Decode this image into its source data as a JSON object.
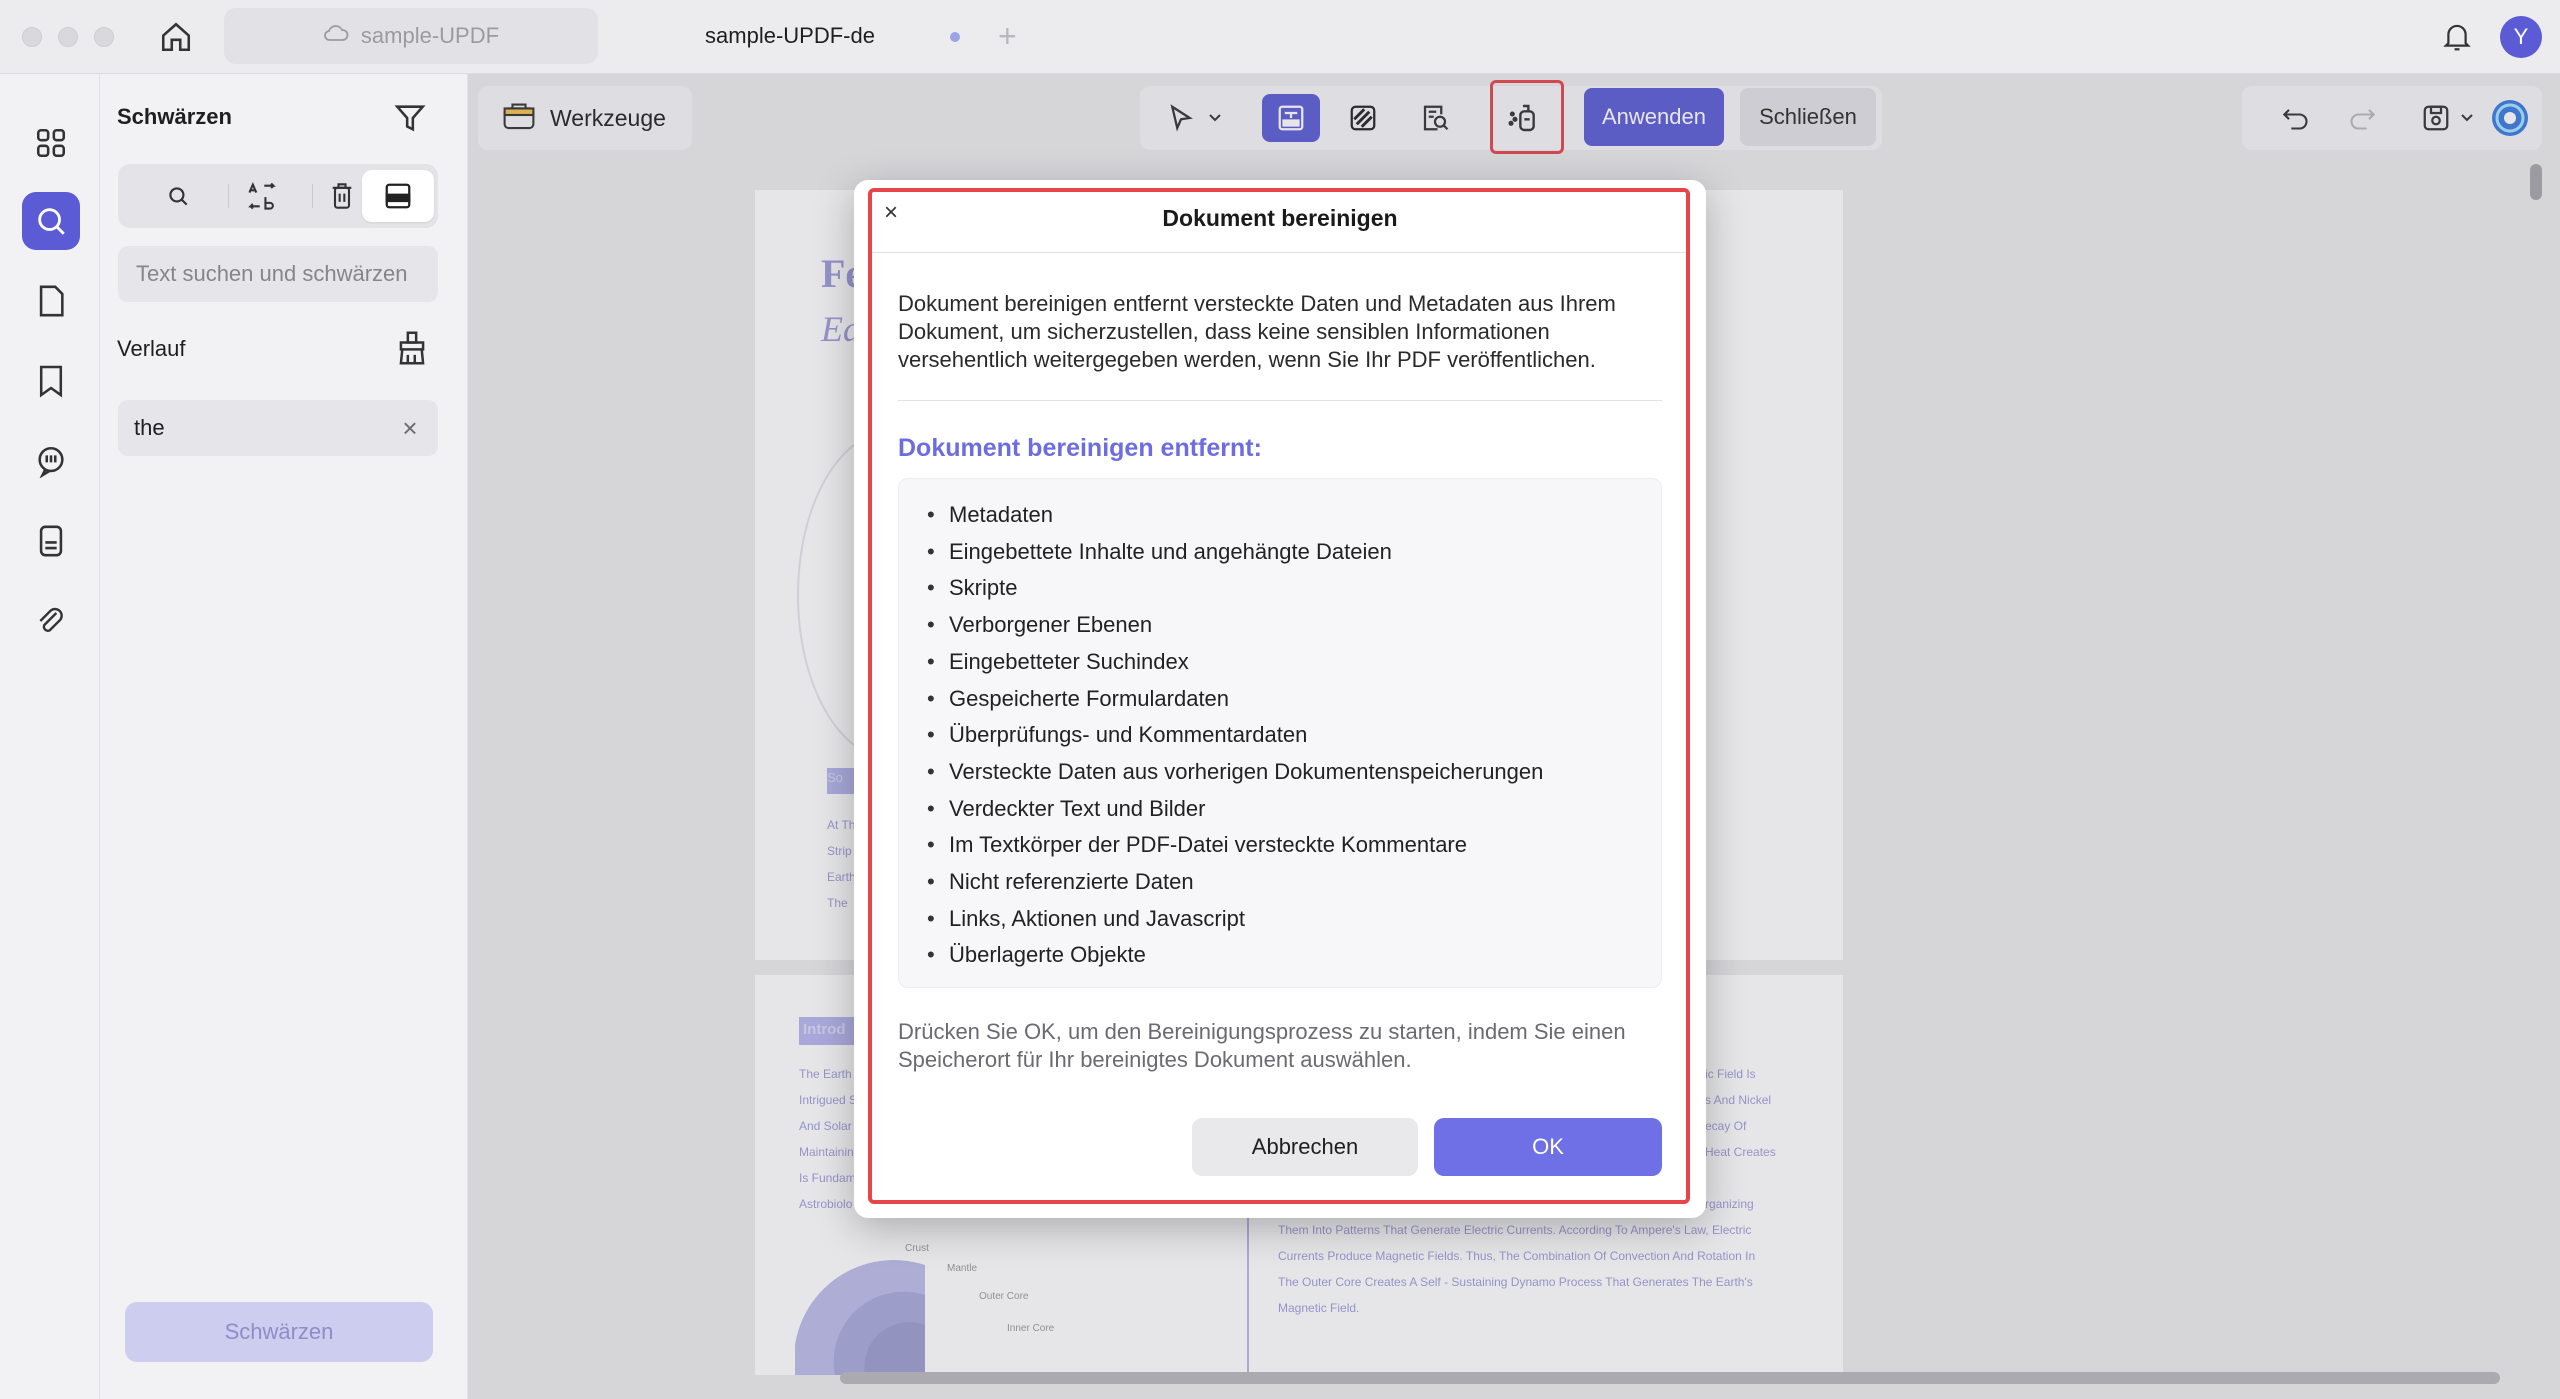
{
  "titlebar": {
    "tabs": [
      {
        "label": "sample-UPDF"
      },
      {
        "label": "sample-UPDF-de"
      }
    ],
    "avatar_initial": "Y"
  },
  "panel": {
    "title": "Schwärzen",
    "search_placeholder": "Text suchen und schwärzen",
    "history_label": "Verlauf",
    "history_items": [
      "the"
    ],
    "redact_button": "Schwärzen"
  },
  "toolbar": {
    "tools_label": "Werkzeuge",
    "apply_label": "Anwenden",
    "close_label": "Schließen"
  },
  "dialog": {
    "title": "Dokument bereinigen",
    "description": "Dokument bereinigen entfernt versteckte Daten und Metadaten aus Ihrem Dokument, um sicherzustellen, dass keine sensiblen Informationen versehentlich weitergegeben werden, wenn Sie Ihr PDF veröffentlichen.",
    "list_title": "Dokument bereinigen entfernt:",
    "items": [
      "Metadaten",
      "Eingebettete Inhalte und angehängte Dateien",
      "Skripte",
      "Verborgener Ebenen",
      "Eingebetteter Suchindex",
      "Gespeicherte Formulardaten",
      "Überprüfungs- und Kommentardaten",
      "Versteckte Daten aus vorherigen Dokumentenspeicherungen",
      "Verdeckter Text und Bilder",
      "Im Textkörper der PDF-Datei versteckte Kommentare",
      "Nicht referenzierte Daten",
      "Links, Aktionen und Javascript",
      "Überlagerte Objekte"
    ],
    "footer": "Drücken Sie OK, um den Bereinigungsprozess zu starten, indem Sie einen Speicherort für Ihr bereinigtes Dokument auswählen.",
    "cancel_label": "Abbrechen",
    "ok_label": "OK"
  },
  "document": {
    "page1_fragments": [
      "Fe",
      "Ea",
      "So",
      "At Th",
      "Strip",
      "Earth",
      "The"
    ],
    "page2_fragments": [
      "Introd",
      "The Earth",
      "Intrigued S",
      "And Solar",
      "Maintainin",
      "Is Fundam",
      "Astrobiolo",
      "Crust",
      "Mantle",
      "Outer Core",
      "Inner Core"
    ],
    "page2_right_text": [
      "ic Field Is",
      "s And Nickel",
      "ecay Of",
      "Heat Creates",
      "rganizing",
      "Them Into Patterns That Generate Electric Currents. According To Ampere's Law, Electric",
      "Currents Produce Magnetic Fields. Thus, The Combination Of Convection And Rotation In",
      "The Outer Core Creates A Self - Sustaining Dynamo Process That Generates The Earth's",
      "Magnetic Field."
    ]
  },
  "colors": {
    "accent": "#5b5bd6",
    "highlight": "#e5454b",
    "subtitle": "#6d6de0"
  }
}
